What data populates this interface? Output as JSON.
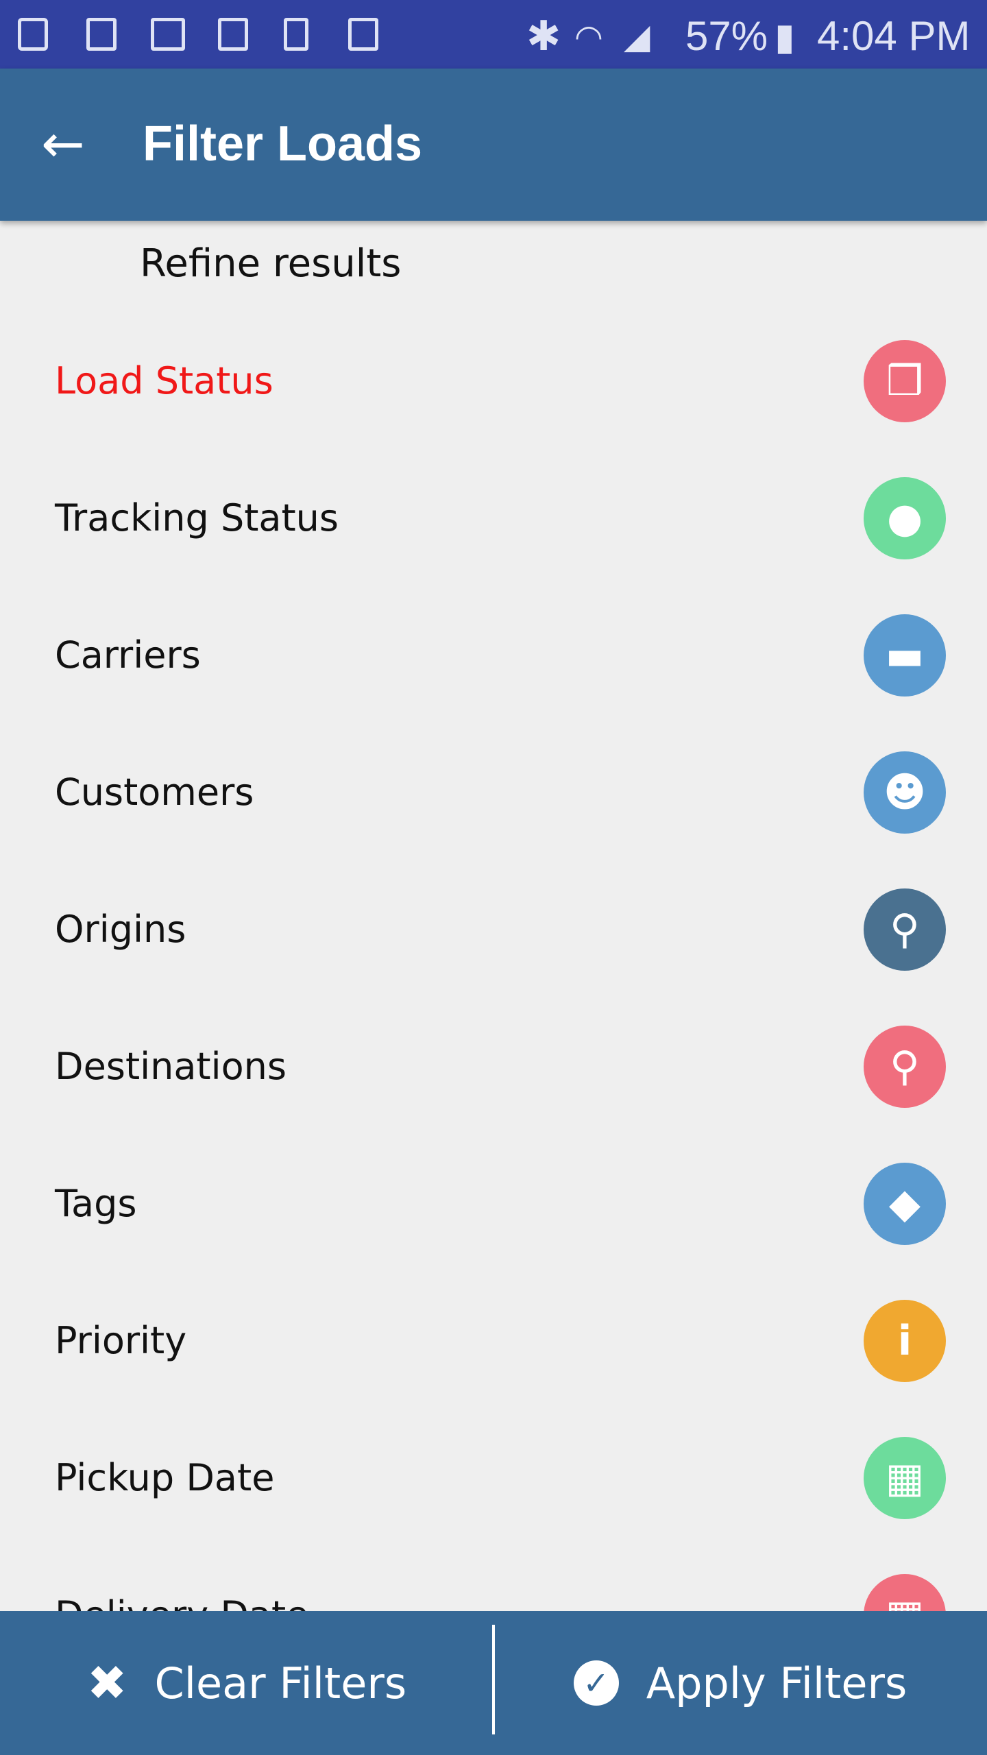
{
  "status_bar": {
    "battery": "57%",
    "time": "4:04 PM",
    "icons": [
      "download-done-icon",
      "image-icon",
      "email-icon",
      "calendar-icon",
      "phone-exit-icon",
      "clipboard-check-icon",
      "bluetooth-icon",
      "wifi-icon",
      "signal-icon",
      "battery-charging-icon"
    ]
  },
  "app_bar": {
    "title": "Filter Loads",
    "back_icon": "arrow-left-icon"
  },
  "subtitle": "Refine results",
  "filters": [
    {
      "label": "Load Status",
      "icon": "boxes-icon",
      "color": "#f06e7e",
      "active": true
    },
    {
      "label": "Tracking Status",
      "icon": "map-pin-icon",
      "color": "#6ddc9c"
    },
    {
      "label": "Carriers",
      "icon": "truck-icon",
      "color": "#5b9bd0"
    },
    {
      "label": "Customers",
      "icon": "users-icon",
      "color": "#5b9bd0"
    },
    {
      "label": "Origins",
      "icon": "pushpin-icon",
      "color": "#4a7190"
    },
    {
      "label": "Destinations",
      "icon": "pushpin-icon",
      "color": "#f06e7e"
    },
    {
      "label": "Tags",
      "icon": "tags-icon",
      "color": "#5b9bd0"
    },
    {
      "label": "Priority",
      "icon": "info-icon",
      "color": "#f0a830"
    },
    {
      "label": "Pickup Date",
      "icon": "calendar-icon",
      "color": "#6ddc9c"
    },
    {
      "label": "Delivery Date",
      "icon": "calendar-icon",
      "color": "#f06e7e"
    }
  ],
  "footer": {
    "clear_label": "Clear Filters",
    "apply_label": "Apply Filters"
  },
  "colors": {
    "status_bar": "#3141a0",
    "app_bar": "#366896",
    "active": "#f01818"
  }
}
